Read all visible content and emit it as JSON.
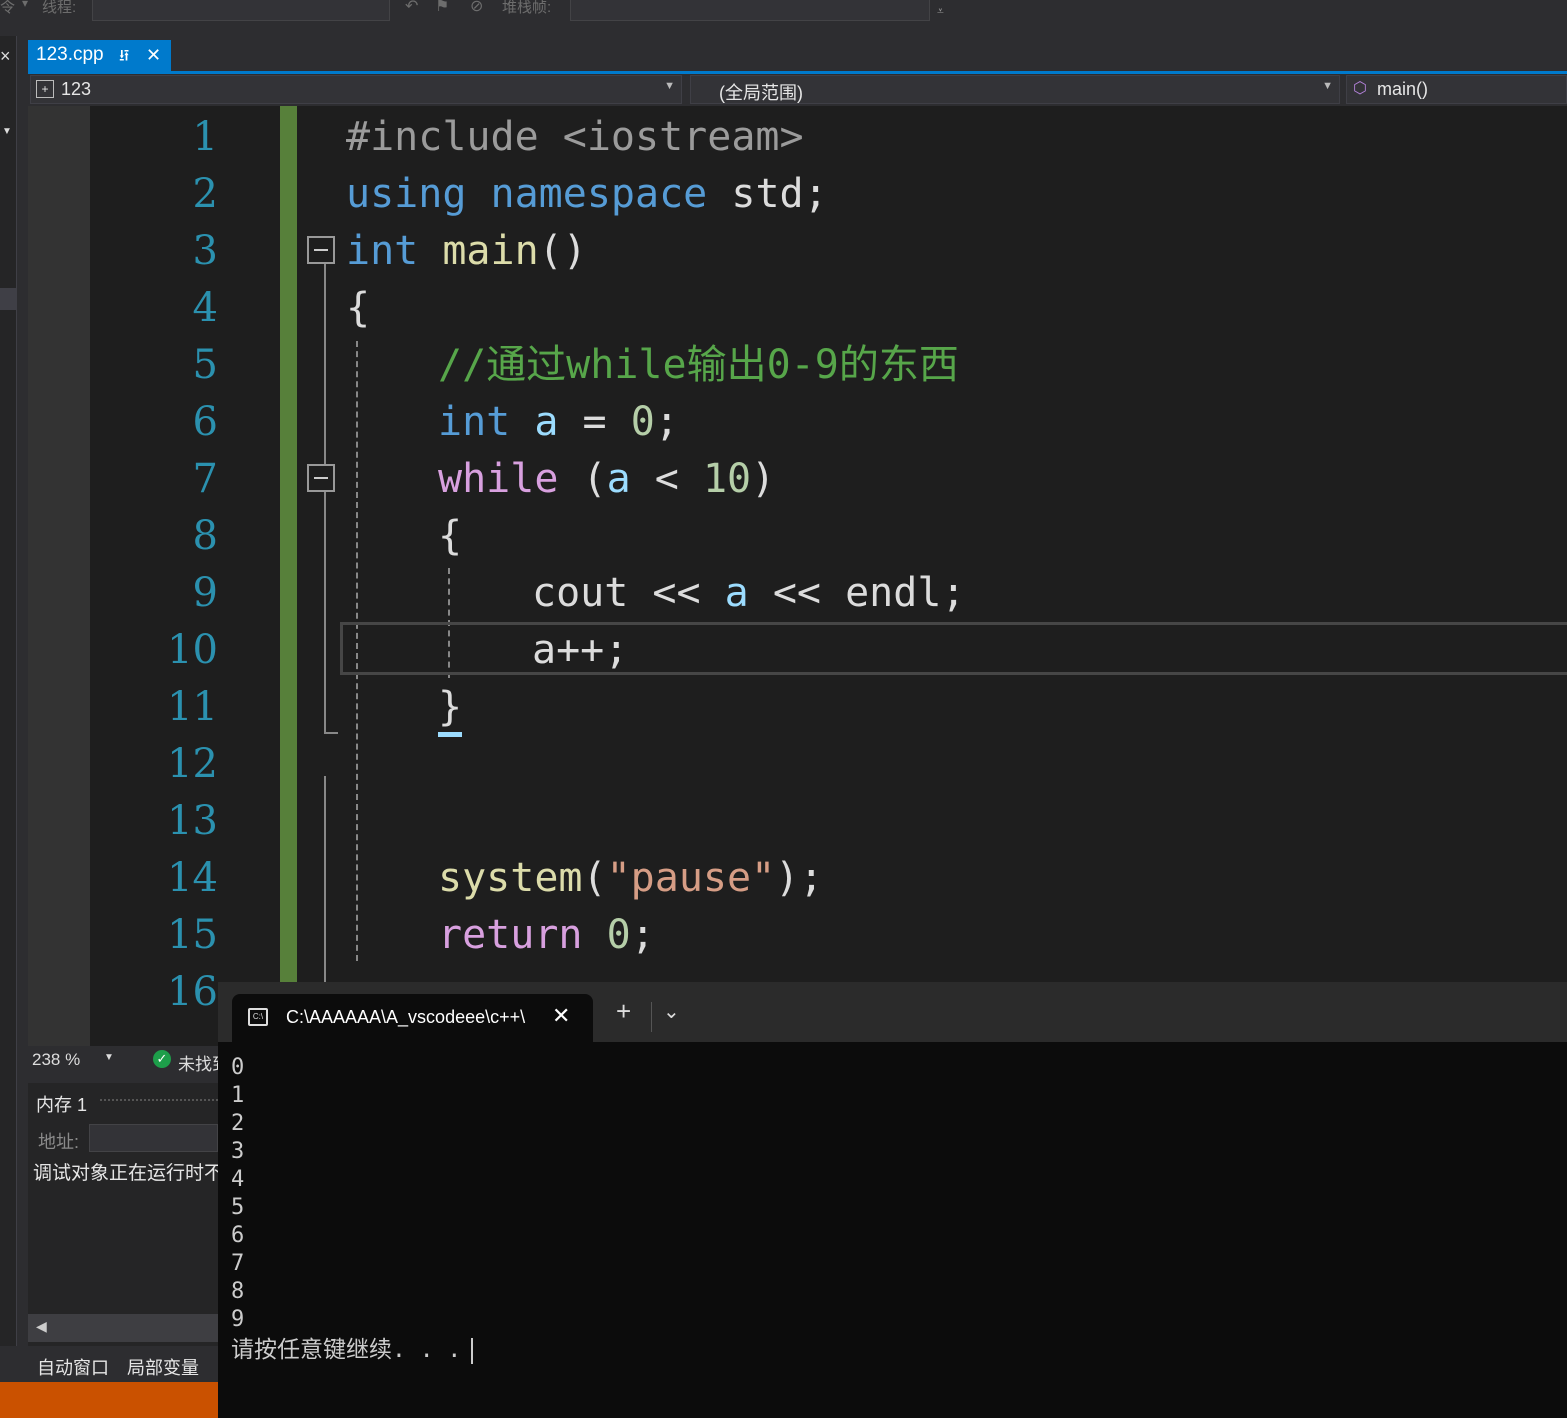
{
  "toolbar": {
    "thread_label": "线程:",
    "stackframe_label": "堆栈帧:",
    "left_fragment": "令"
  },
  "tab": {
    "filename": "123.cpp",
    "pin_glyph": "⭿",
    "close_glyph": "✕"
  },
  "navbar": {
    "project": "123",
    "scope": "(全局范围)",
    "member": "main()"
  },
  "editor": {
    "line_numbers": [
      "1",
      "2",
      "3",
      "4",
      "5",
      "6",
      "7",
      "8",
      "9",
      "10",
      "11",
      "12",
      "13",
      "14",
      "15",
      "16"
    ],
    "lines": {
      "l1": "#include <iostream>",
      "l2_kw1": "using",
      "l2_kw2": "namespace",
      "l2_rest": "std;",
      "l3_kw": "int",
      "l3_fn": "main",
      "l3_rest": "()",
      "l4": "{",
      "l5": "//通过while输出0-9的东西",
      "l6_kw": "int",
      "l6_var": "a",
      "l6_op": " = ",
      "l6_num": "0",
      "l6_end": ";",
      "l7_kw": "while",
      "l7_p": " (",
      "l7_var": "a",
      "l7_op": " < ",
      "l7_num": "10",
      "l7_end": ")",
      "l8": "{",
      "l9_a": "cout << ",
      "l9_var": "a",
      "l9_b": " << endl;",
      "l10": "a++;",
      "l11": "}",
      "l14_fn": "system",
      "l14_p": "(",
      "l14_str": "\"pause\"",
      "l14_end": ");",
      "l15_kw": "return",
      "l15_sp": " ",
      "l15_num": "0",
      "l15_end": ";"
    }
  },
  "status": {
    "zoom": "238 %",
    "issues": "未找到"
  },
  "memory_panel": {
    "title": "内存 1",
    "address_label": "地址:",
    "message": "调试对象正在运行时不"
  },
  "bottom_tabs": [
    "自动窗口",
    "局部变量"
  ],
  "terminal": {
    "tab_title": "C:\\AAAAAA\\A_vscodeee\\c++\\",
    "new_tab": "+",
    "dropdown": "⌄",
    "output": [
      "0",
      "1",
      "2",
      "3",
      "4",
      "5",
      "6",
      "7",
      "8",
      "9"
    ],
    "prompt": "请按任意键继续. . ."
  }
}
